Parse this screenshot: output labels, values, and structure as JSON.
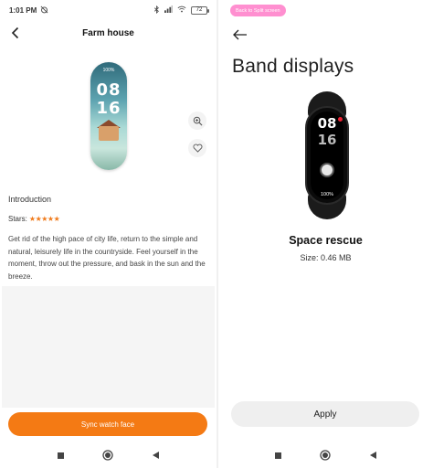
{
  "status_bar": {
    "time": "1:01 PM",
    "battery": "72"
  },
  "left": {
    "title": "Farm house",
    "watch_face": {
      "top_text": "100%",
      "hour": "08",
      "minute": "16"
    },
    "intro_label": "Introduction",
    "stars_label": "Stars:",
    "stars_value": "★★★★★",
    "rating": 5,
    "description": "Get rid of the high pace of city life, return to the simple and natural, leisurely life in the countryside. Feel yourself in the moment, throw out the pressure, and bask in the sun and the breeze.",
    "sync_label": "Sync watch face"
  },
  "right": {
    "split_label": "Back to Split screen",
    "title": "Band displays",
    "band": {
      "hour": "08",
      "minute": "16",
      "battery": "100%"
    },
    "face_name": "Space rescue",
    "face_size": "Size: 0.46 MB",
    "apply_label": "Apply"
  },
  "colors": {
    "accent": "#f47a14",
    "split_pill": "#ff8fd0"
  },
  "icons": [
    "back-arrow-icon",
    "zoom-in-icon",
    "heart-icon",
    "nav-square-icon",
    "nav-circle-icon",
    "nav-triangle-icon"
  ]
}
